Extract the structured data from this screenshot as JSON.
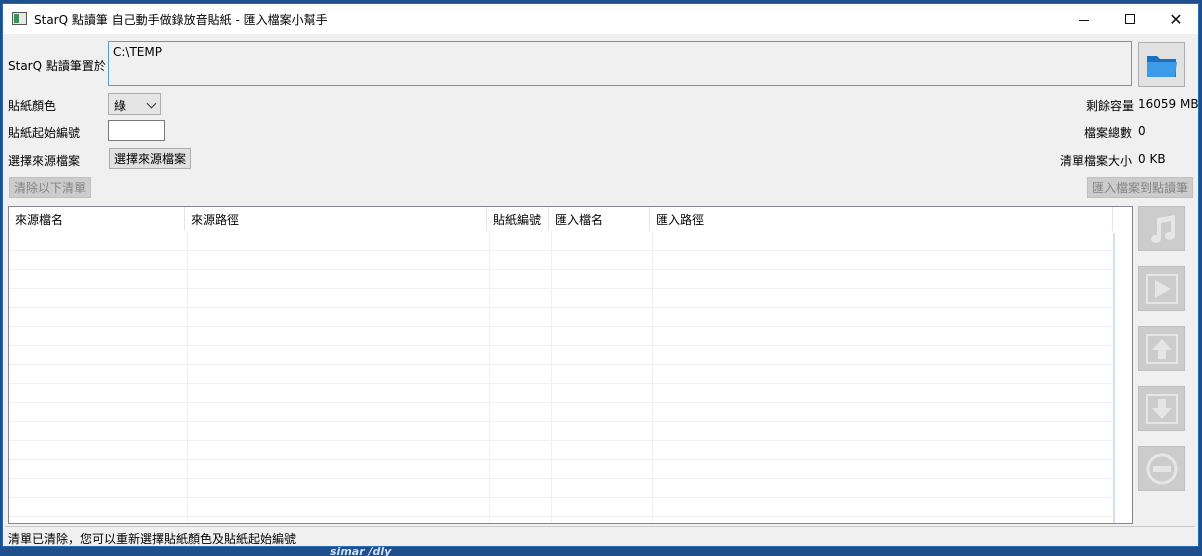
{
  "window": {
    "title": "StarQ 點讀筆 自己動手做錄放音貼紙 - 匯入檔案小幫手"
  },
  "pen_location": {
    "label": "StarQ 點讀筆置於",
    "value": "C:\\TEMP"
  },
  "sticker_color": {
    "label": "貼紙顏色",
    "selected": "綠"
  },
  "sticker_start": {
    "label": "貼紙起始編號",
    "value": ""
  },
  "source_file": {
    "label": "選擇來源檔案",
    "button": "選擇來源檔案"
  },
  "info": {
    "free_space_label": "剩餘容量",
    "free_space_value": "16059 MB",
    "file_count_label": "檔案總數",
    "file_count_value": "0",
    "list_size_label": "清單檔案大小",
    "list_size_value": "0 KB"
  },
  "buttons": {
    "clear_list": "清除以下清單",
    "import_to_pen": "匯入檔案到點讀筆"
  },
  "table": {
    "columns": [
      "來源檔名",
      "來源路徑",
      "貼紙編號",
      "匯入檔名",
      "匯入路徑"
    ],
    "rows": []
  },
  "status": {
    "text": "清單已清除，您可以重新選擇貼紙顏色及貼紙起始編號"
  },
  "desktop": {
    "text": "simar /dly"
  },
  "icons": {
    "folder": "folder-icon",
    "music": "music-note-icon",
    "play": "play-icon",
    "up": "arrow-up-icon",
    "down": "arrow-down-icon",
    "remove": "remove-icon"
  }
}
